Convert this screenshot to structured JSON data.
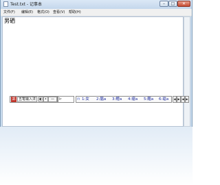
{
  "window": {
    "title": "Test.txt - 记事本",
    "controls": {
      "minimize": "–",
      "maximize": "□",
      "close": "✕"
    }
  },
  "menu": [
    {
      "label": "文件(F)"
    },
    {
      "label": "编辑(E)"
    },
    {
      "label": "格式(O)"
    },
    {
      "label": "查看(V)"
    },
    {
      "label": "帮助(H)"
    }
  ],
  "editor": {
    "text": "男硒"
  },
  "ime": {
    "logo": "郑",
    "name": "五笔输入法",
    "buttons": [
      "◐",
      "•",
      "—"
    ],
    "composition": "lr",
    "candidates_icon": "ꯁ",
    "candidates": [
      "1:女",
      "2:腽a",
      "3:鳢a",
      "4:瘤a",
      "5:醢a",
      "6:瑲a"
    ],
    "page_buttons": [
      "◀",
      "▶",
      "◀",
      "▶"
    ]
  },
  "colors": {
    "window_frame": "#c9dcef",
    "candidate_text": "#1b2a9c",
    "ime_logo": "#c0352b"
  }
}
